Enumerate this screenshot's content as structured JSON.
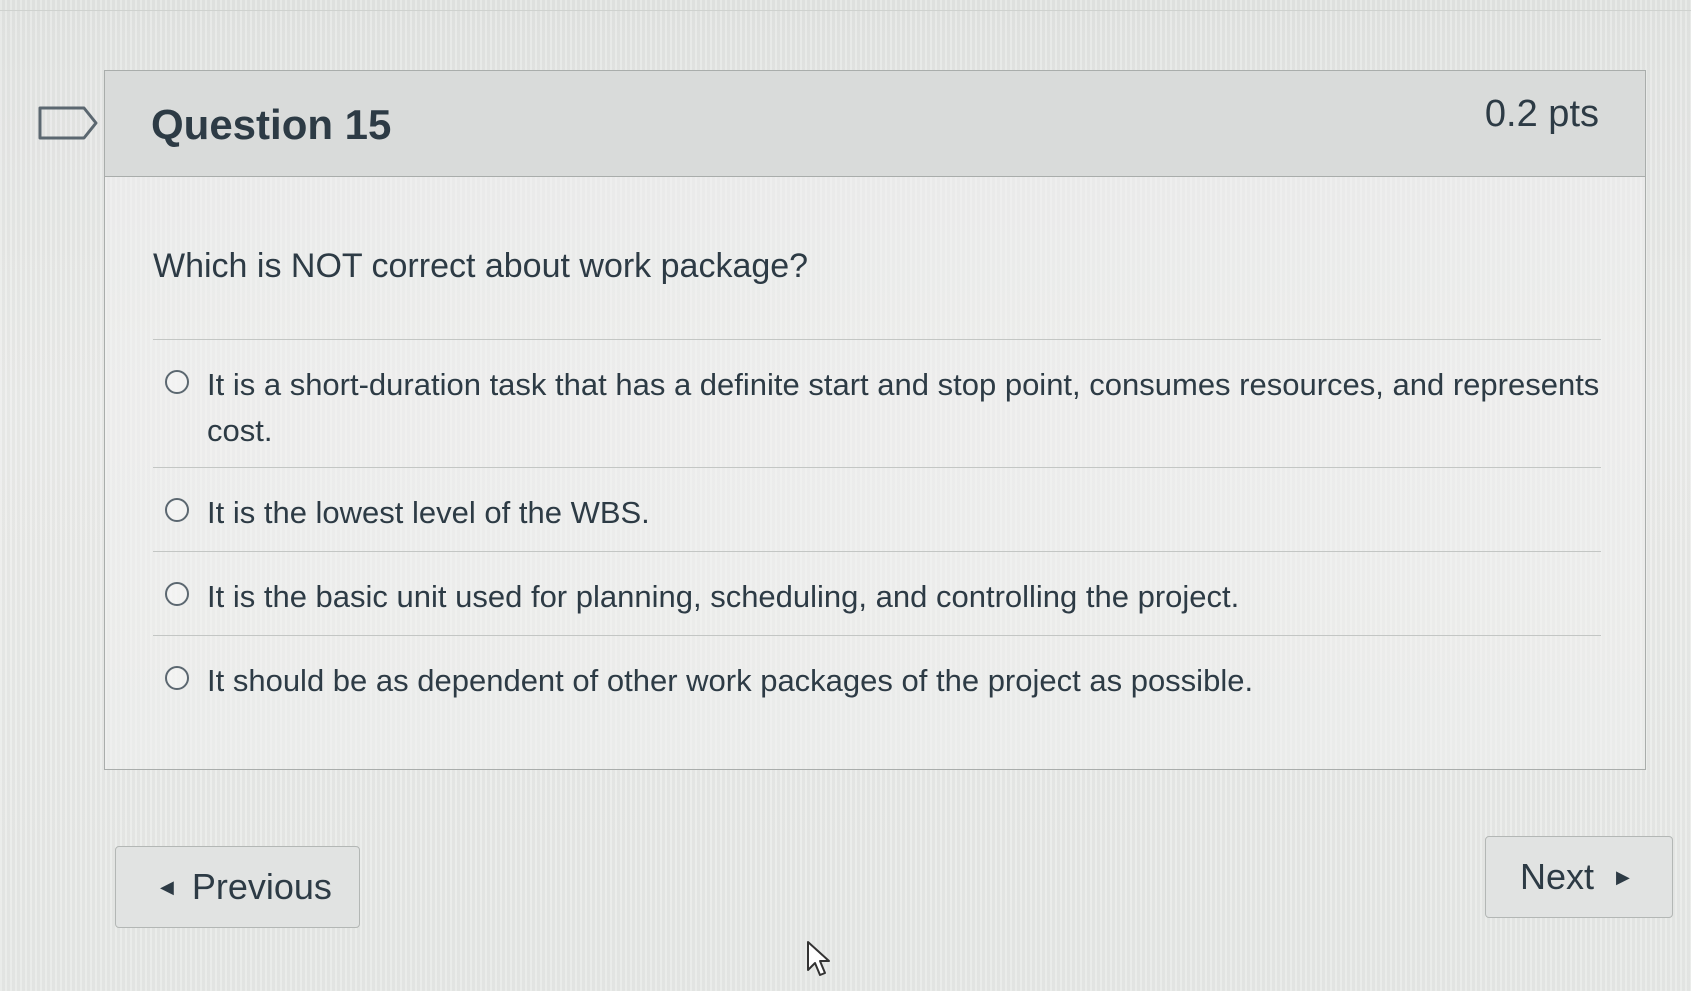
{
  "question": {
    "title": "Question 15",
    "points": "0.2 pts",
    "text": "Which is NOT correct about work package?",
    "bookmark_icon": "bookmark-flag-icon"
  },
  "answers": [
    {
      "label": "It is a short-duration task that has a definite start and stop point, consumes resources, and represents cost.",
      "selected": false
    },
    {
      "label": "It is the lowest level of the WBS.",
      "selected": false
    },
    {
      "label": "It is the basic unit used for planning, scheduling, and controlling the project.",
      "selected": false
    },
    {
      "label": "It should be as dependent of other work packages of the project as possible.",
      "selected": false
    }
  ],
  "navigation": {
    "previous_label": "Previous",
    "next_label": "Next",
    "previous_icon": "caret-left-icon",
    "next_icon": "caret-right-icon"
  },
  "cursor_icon": "mouse-pointer-icon",
  "colors": {
    "text": "#2d3b45",
    "border": "#a9adab",
    "header_bg": "#d9dbda"
  }
}
